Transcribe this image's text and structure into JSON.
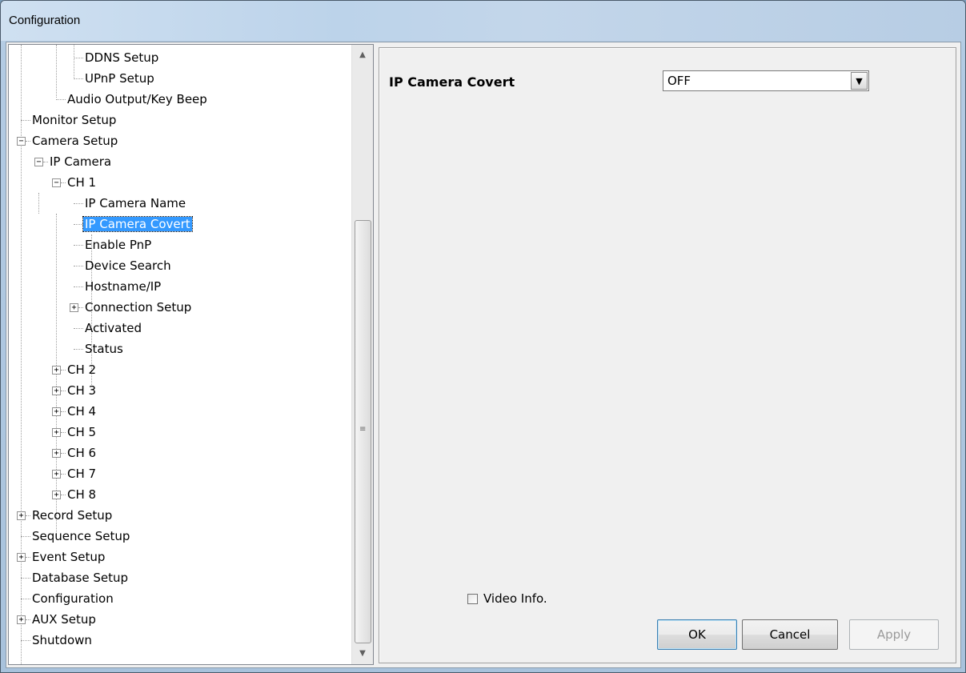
{
  "window": {
    "title": "Configuration"
  },
  "tree": {
    "nodes": [
      {
        "label": "DDNS Setup",
        "depth": 3,
        "toggle": ""
      },
      {
        "label": "UPnP Setup",
        "depth": 3,
        "toggle": ""
      },
      {
        "label": "Audio Output/Key Beep",
        "depth": 2,
        "toggle": ""
      },
      {
        "label": "Monitor Setup",
        "depth": 0,
        "toggle": ""
      },
      {
        "label": "Camera Setup",
        "depth": 0,
        "toggle": "−"
      },
      {
        "label": "IP Camera",
        "depth": 1,
        "toggle": "−"
      },
      {
        "label": "CH 1",
        "depth": 2,
        "toggle": "−"
      },
      {
        "label": "IP Camera Name",
        "depth": 3,
        "toggle": ""
      },
      {
        "label": "IP Camera Covert",
        "depth": 3,
        "toggle": "",
        "selected": true
      },
      {
        "label": "Enable PnP",
        "depth": 3,
        "toggle": ""
      },
      {
        "label": "Device Search",
        "depth": 3,
        "toggle": ""
      },
      {
        "label": "Hostname/IP",
        "depth": 3,
        "toggle": ""
      },
      {
        "label": "Connection Setup",
        "depth": 3,
        "toggle": "+"
      },
      {
        "label": "Activated",
        "depth": 3,
        "toggle": ""
      },
      {
        "label": "Status",
        "depth": 3,
        "toggle": ""
      },
      {
        "label": "CH 2",
        "depth": 2,
        "toggle": "+"
      },
      {
        "label": "CH 3",
        "depth": 2,
        "toggle": "+"
      },
      {
        "label": "CH 4",
        "depth": 2,
        "toggle": "+"
      },
      {
        "label": "CH 5",
        "depth": 2,
        "toggle": "+"
      },
      {
        "label": "CH 6",
        "depth": 2,
        "toggle": "+"
      },
      {
        "label": "CH 7",
        "depth": 2,
        "toggle": "+"
      },
      {
        "label": "CH 8",
        "depth": 2,
        "toggle": "+"
      },
      {
        "label": "Record Setup",
        "depth": 0,
        "toggle": "+"
      },
      {
        "label": "Sequence Setup",
        "depth": 0,
        "toggle": ""
      },
      {
        "label": "Event Setup",
        "depth": 0,
        "toggle": "+"
      },
      {
        "label": "Database Setup",
        "depth": 0,
        "toggle": ""
      },
      {
        "label": "Configuration",
        "depth": 0,
        "toggle": ""
      },
      {
        "label": "AUX Setup",
        "depth": 0,
        "toggle": "+"
      },
      {
        "label": "Shutdown",
        "depth": 0,
        "toggle": ""
      }
    ]
  },
  "panel": {
    "property_label": "IP Camera Covert",
    "property_value": "OFF",
    "video_info_label": "Video Info.",
    "video_info_checked": false
  },
  "buttons": {
    "ok": "OK",
    "cancel": "Cancel",
    "apply": "Apply"
  },
  "icons": {
    "scroll_up": "scroll-up-arrow-icon",
    "scroll_down": "scroll-down-arrow-icon",
    "combo": "dropdown-arrow-icon"
  },
  "colors": {
    "selection": "#3399ff",
    "tree_lines": "#a0a0a0"
  }
}
